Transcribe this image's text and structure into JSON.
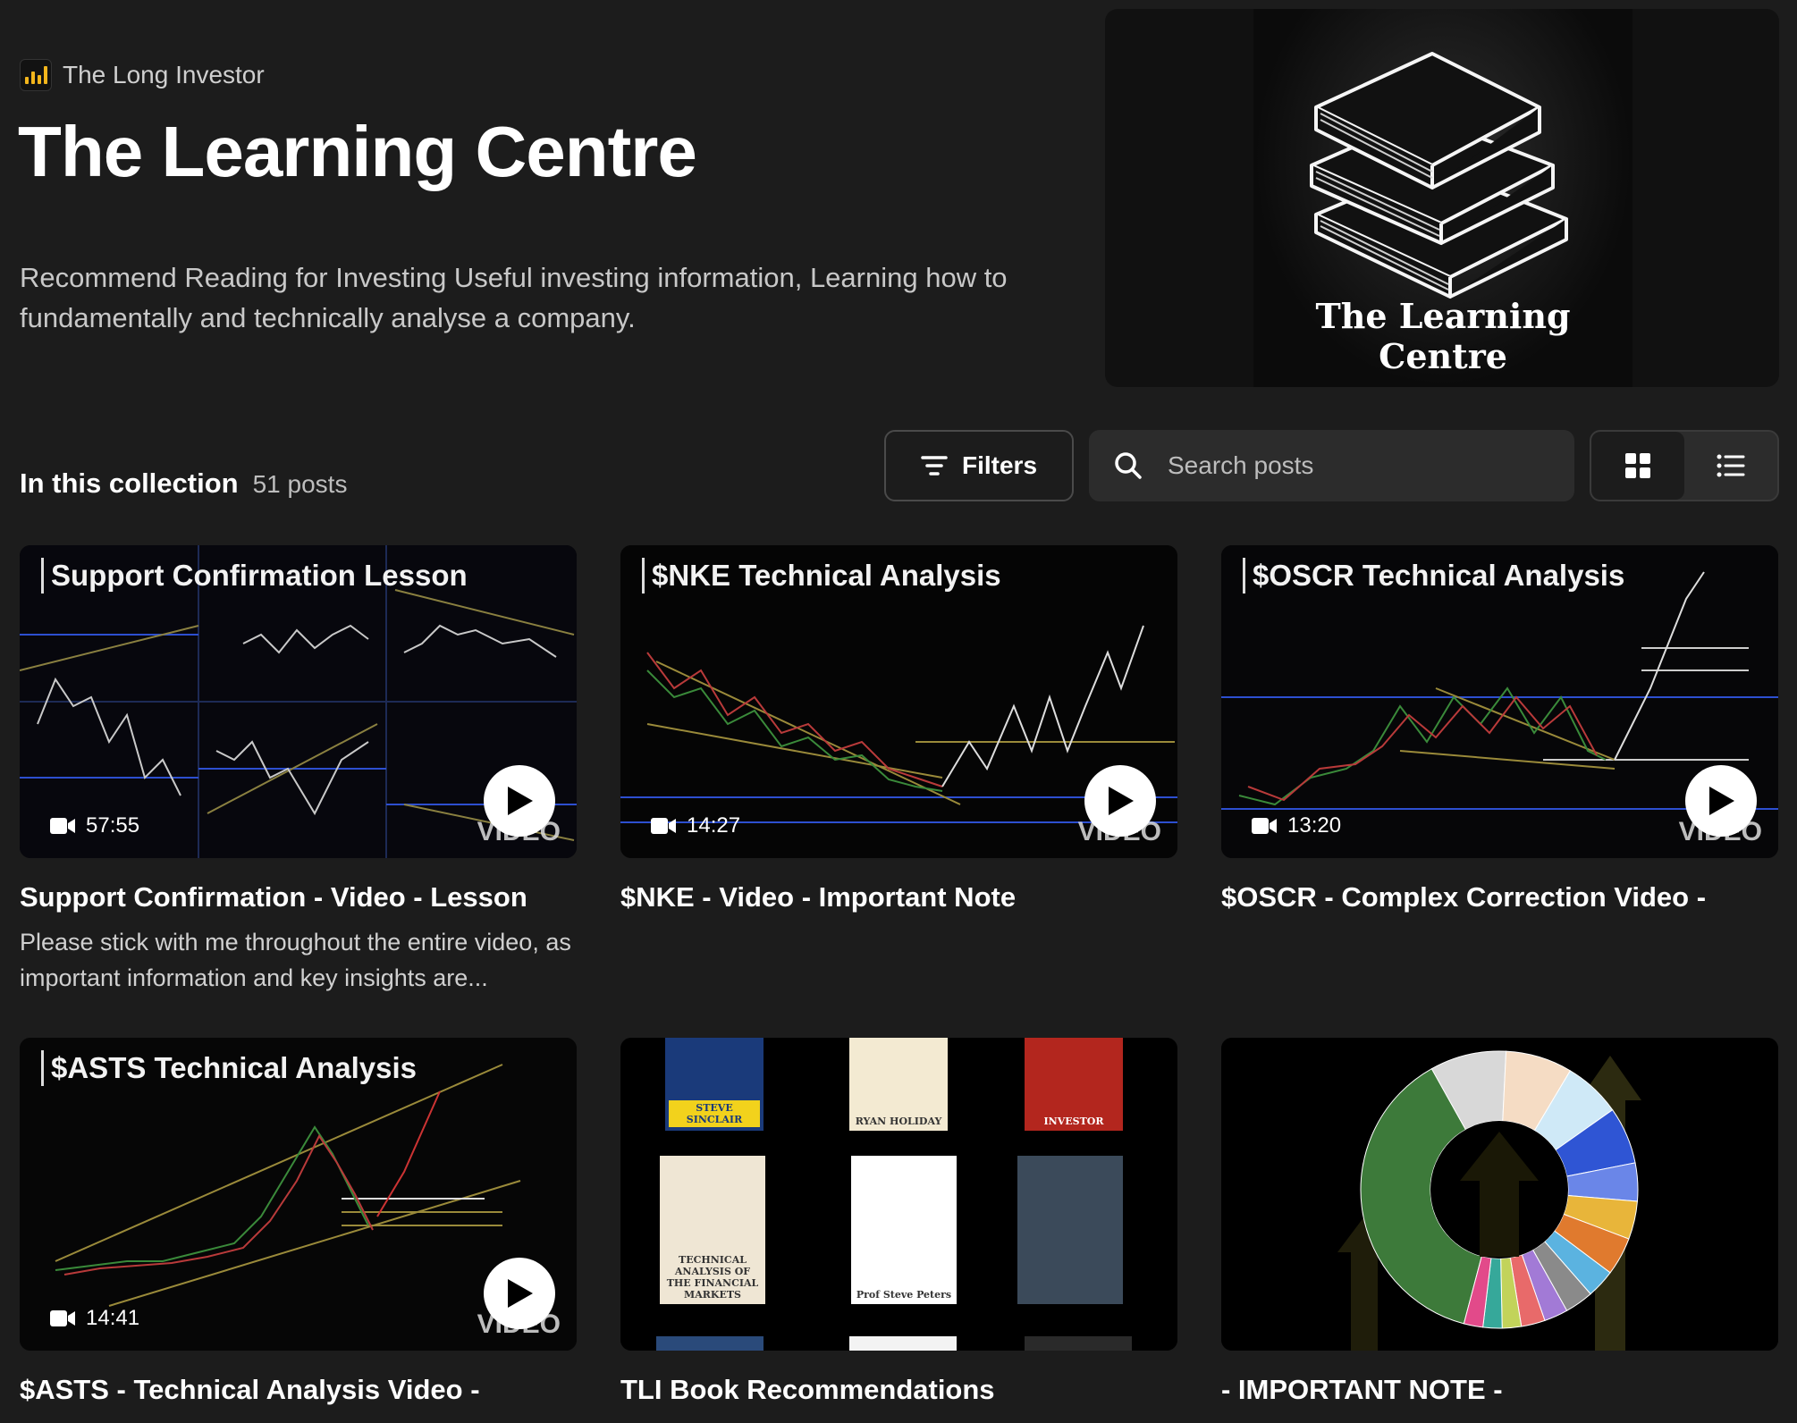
{
  "header": {
    "creator_name": "The Long Investor",
    "title": "The Learning Centre",
    "description": "Recommend Reading for Investing Useful investing information, Learning how to fundamentally and technically analyse a company.",
    "hero_caption": "The Learning Centre"
  },
  "collection": {
    "label": "In this collection",
    "count": "51 posts"
  },
  "toolbar": {
    "filters_label": "Filters",
    "search_placeholder": "Search posts"
  },
  "posts": [
    {
      "thumb_title": "Support Confirmation Lesson",
      "duration": "57:55",
      "video_word": "VIDEO",
      "title": "Support Confirmation - Video - Lesson",
      "excerpt": "Please stick with me throughout the entire video, as important information and key insights are..."
    },
    {
      "thumb_title": "$NKE Technical Analysis",
      "duration": "14:27",
      "video_word": "VIDEO",
      "title": "$NKE - Video - Important Note"
    },
    {
      "thumb_title": "$OSCR Technical Analysis",
      "duration": "13:20",
      "video_word": "VIDEO",
      "title": "$OSCR - Complex Correction Video -"
    },
    {
      "thumb_title": "$ASTS Technical Analysis",
      "duration": "14:41",
      "video_word": "VIDEO",
      "title": "$ASTS - Technical Analysis Video -"
    },
    {
      "title": "TLI Book Recommendations",
      "books": [
        {
          "text": "STEVE SINCLAIR",
          "color": "#1a3a7a"
        },
        {
          "text": "RYAN HOLIDAY",
          "color": "#f3ead2"
        },
        {
          "text": "INVESTOR",
          "color": "#b3261e"
        },
        {
          "text": "TECHNICAL ANALYSIS OF THE FINANCIAL MARKETS",
          "color": "#efe6d4"
        },
        {
          "text": "Prof Steve Peters",
          "color": "#ffffff"
        },
        {
          "text": "",
          "color": "#3b4a5a"
        }
      ]
    },
    {
      "title": "- IMPORTANT NOTE -",
      "donut_colors": [
        "#3d7a3a",
        "#d8d8d8",
        "#f5dcc4",
        "#cfe9f7",
        "#2f55d4",
        "#6a86e8",
        "#e8b53a",
        "#e07a2e",
        "#5bb3e0",
        "#8a8a8a",
        "#a27ad6",
        "#e86a6a",
        "#c2d35a",
        "#36a89a",
        "#e24a8a"
      ]
    }
  ]
}
